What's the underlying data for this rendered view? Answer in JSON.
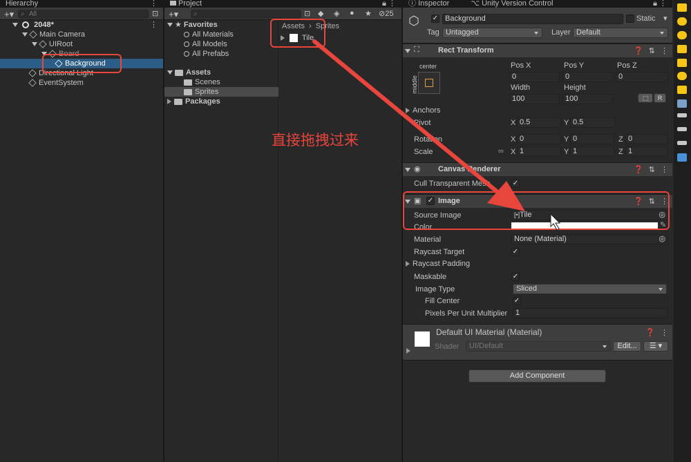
{
  "hierarchy": {
    "tab": "Hierarchy",
    "search_placeholder": "All",
    "scene": "2048*",
    "items": [
      "Main Camera",
      "UIRoot",
      "Board",
      "Background",
      "Directional Light",
      "EventSystem"
    ]
  },
  "project": {
    "tab": "Project",
    "hidden_count": "25",
    "favorites_label": "Favorites",
    "favorites": [
      "All Materials",
      "All Models",
      "All Prefabs"
    ],
    "assets_label": "Assets",
    "asset_folders": [
      "Scenes",
      "Sprites"
    ],
    "packages_label": "Packages",
    "breadcrumb": [
      "Assets",
      "Sprites"
    ],
    "files": [
      "Tile"
    ]
  },
  "annotation": "直接拖拽过来",
  "inspector": {
    "tabs": [
      "Inspector",
      "Unity Version Control"
    ],
    "object_name": "Background",
    "static_label": "Static",
    "tag_label": "Tag",
    "tag_value": "Untagged",
    "layer_label": "Layer",
    "layer_value": "Default",
    "rect_transform": {
      "title": "Rect Transform",
      "anchor_h": "center",
      "anchor_v": "middle",
      "pos_x_label": "Pos X",
      "pos_y_label": "Pos Y",
      "pos_z_label": "Pos Z",
      "pos_x": "0",
      "pos_y": "0",
      "pos_z": "0",
      "width_label": "Width",
      "height_label": "Height",
      "width": "100",
      "height": "100",
      "r_button": "R",
      "anchors_label": "Anchors",
      "pivot_label": "Pivot",
      "pivot_x": "0.5",
      "pivot_y": "0.5",
      "rotation_label": "Rotation",
      "rotation": [
        "0",
        "0",
        "0"
      ],
      "scale_label": "Scale",
      "scale": [
        "1",
        "1",
        "1"
      ],
      "x": "X",
      "y": "Y",
      "z": "Z"
    },
    "canvas_renderer": {
      "title": "Canvas Renderer",
      "cull_label": "Cull Transparent Mesh"
    },
    "image": {
      "title": "Image",
      "source_image_label": "Source Image",
      "source_image_value": "Tile",
      "color_label": "Color",
      "material_label": "Material",
      "material_value": "None (Material)",
      "raycast_target_label": "Raycast Target",
      "raycast_padding_label": "Raycast Padding",
      "maskable_label": "Maskable",
      "image_type_label": "Image Type",
      "image_type_value": "Sliced",
      "fill_center_label": "Fill Center",
      "ppu_label": "Pixels Per Unit Multiplier",
      "ppu_value": "1"
    },
    "material": {
      "title": "Default UI Material (Material)",
      "shader_label": "Shader",
      "shader_value": "UI/Default",
      "edit_button": "Edit..."
    },
    "add_component": "Add Component"
  },
  "colors": {
    "annotation_red": "#e8453c",
    "strip_yellow": "#f5c518"
  }
}
